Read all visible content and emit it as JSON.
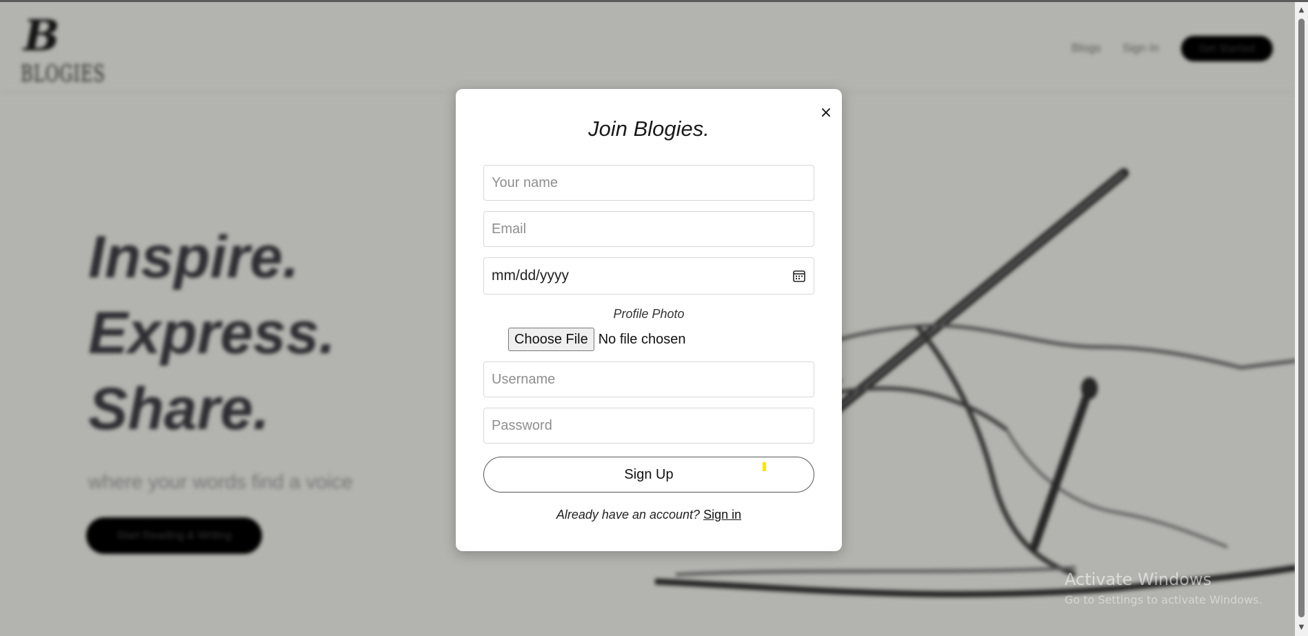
{
  "background": {
    "nav": {
      "blogs": "Blogs",
      "sign_in": "Sign In",
      "get_started": "Get Started"
    },
    "hero": {
      "line1": "Inspire.",
      "line2": "Express.",
      "line3": "Share."
    },
    "tagline": "where your words find a voice",
    "cta": "Start Reading & Writing",
    "logo_text": "BLOGIES"
  },
  "watermark": {
    "title": "Activate Windows",
    "subtitle": "Go to Settings to activate Windows."
  },
  "modal": {
    "close": "×",
    "title": "Join Blogies.",
    "name_placeholder": "Your name",
    "email_placeholder": "Email",
    "date_placeholder": "mm/dd/yyyy",
    "photo_label": "Profile Photo",
    "file_button": "Choose File",
    "file_status": "No file chosen",
    "username_placeholder": "Username",
    "password_placeholder": "Password",
    "submit": "Sign Up",
    "already_text": "Already have an account?",
    "sign_in_link": "Sign in"
  },
  "colors": {
    "overlay": "#000000",
    "accent": "#000000",
    "cursor_highlight": "#ffe400"
  }
}
